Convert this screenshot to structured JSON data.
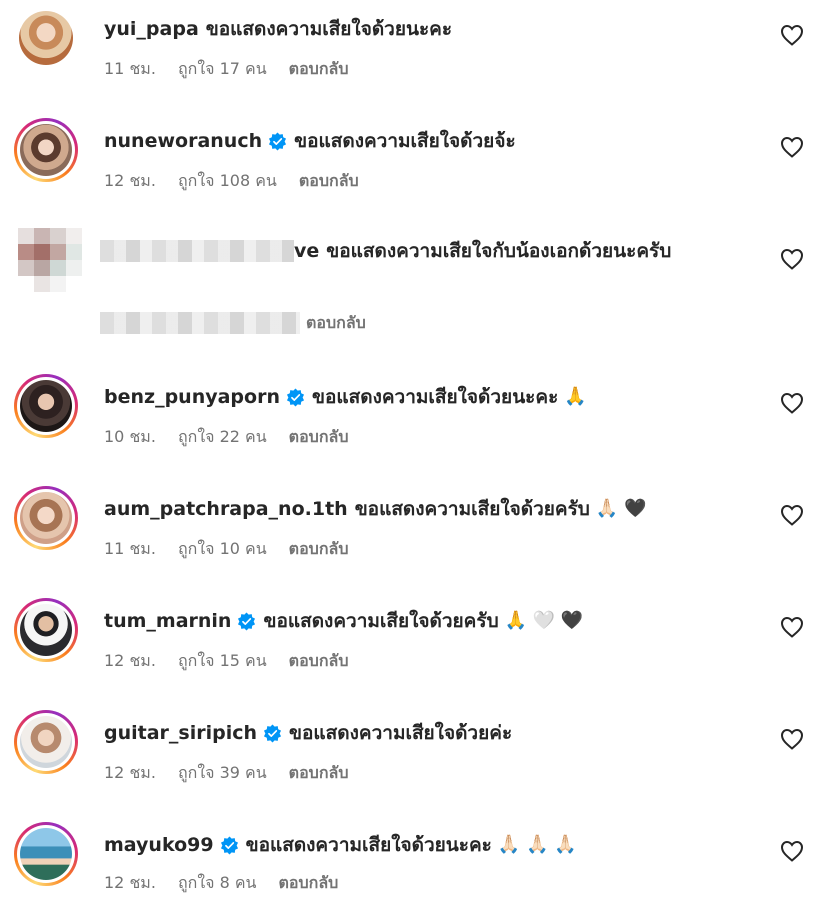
{
  "comments": [
    {
      "username": "yui_papa",
      "verified": false,
      "story_ring": false,
      "text": "ขอแสดงความเสียใจด้วยนะคะ",
      "emoji": "",
      "time": "11 ชม.",
      "likes": "ถูกใจ 17 คน",
      "reply": "ตอบกลับ"
    },
    {
      "username": "nuneworanuch",
      "verified": true,
      "story_ring": true,
      "text": "ขอแสดงความเสียใจด้วยจ้ะ",
      "emoji": "",
      "time": "12 ชม.",
      "likes": "ถูกใจ 108 คน",
      "reply": "ตอบกลับ"
    },
    {
      "username": "",
      "username_tail": "ve",
      "blurred": true,
      "verified": false,
      "story_ring": false,
      "text": "ขอแสดงความเสียใจกับน้องเอกด้วยนะครับ",
      "emoji": "",
      "time": "",
      "likes": "",
      "reply": "ตอบกลับ"
    },
    {
      "username": "benz_punyaporn",
      "verified": true,
      "story_ring": true,
      "text": "ขอแสดงความเสียใจด้วยนะคะ",
      "emoji": "🙏",
      "time": "10 ชม.",
      "likes": "ถูกใจ 22 คน",
      "reply": "ตอบกลับ"
    },
    {
      "username": "aum_patchrapa_no.1th",
      "verified": false,
      "story_ring": true,
      "text": "ขอแสดงความเสียใจด้วยครับ",
      "emoji": "🙏🏻 🖤",
      "time": "11 ชม.",
      "likes": "ถูกใจ 10 คน",
      "reply": "ตอบกลับ"
    },
    {
      "username": "tum_marnin",
      "verified": true,
      "story_ring": true,
      "text": "ขอแสดงความเสียใจด้วยครับ",
      "emoji": "🙏 🤍 🖤",
      "time": "12 ชม.",
      "likes": "ถูกใจ 15 คน",
      "reply": "ตอบกลับ"
    },
    {
      "username": "guitar_siripich",
      "verified": true,
      "story_ring": true,
      "text": "ขอแสดงความเสียใจด้วยค่ะ",
      "emoji": "",
      "time": "12 ชม.",
      "likes": "ถูกใจ 39 คน",
      "reply": "ตอบกลับ"
    },
    {
      "username": "mayuko99",
      "verified": true,
      "story_ring": true,
      "text": "ขอแสดงความเสียใจด้วยนะคะ",
      "emoji": "🙏🏻 🙏🏻 🙏🏻",
      "time": "12 ชม.",
      "likes": "ถูกใจ 8 คน",
      "reply": "ตอบกลับ"
    }
  ],
  "colors": {
    "text": "#262626",
    "secondary": "#737373",
    "verified": "#0095f6"
  },
  "icons": {
    "like": "heart-outline-icon",
    "verified": "verified-badge-icon"
  }
}
